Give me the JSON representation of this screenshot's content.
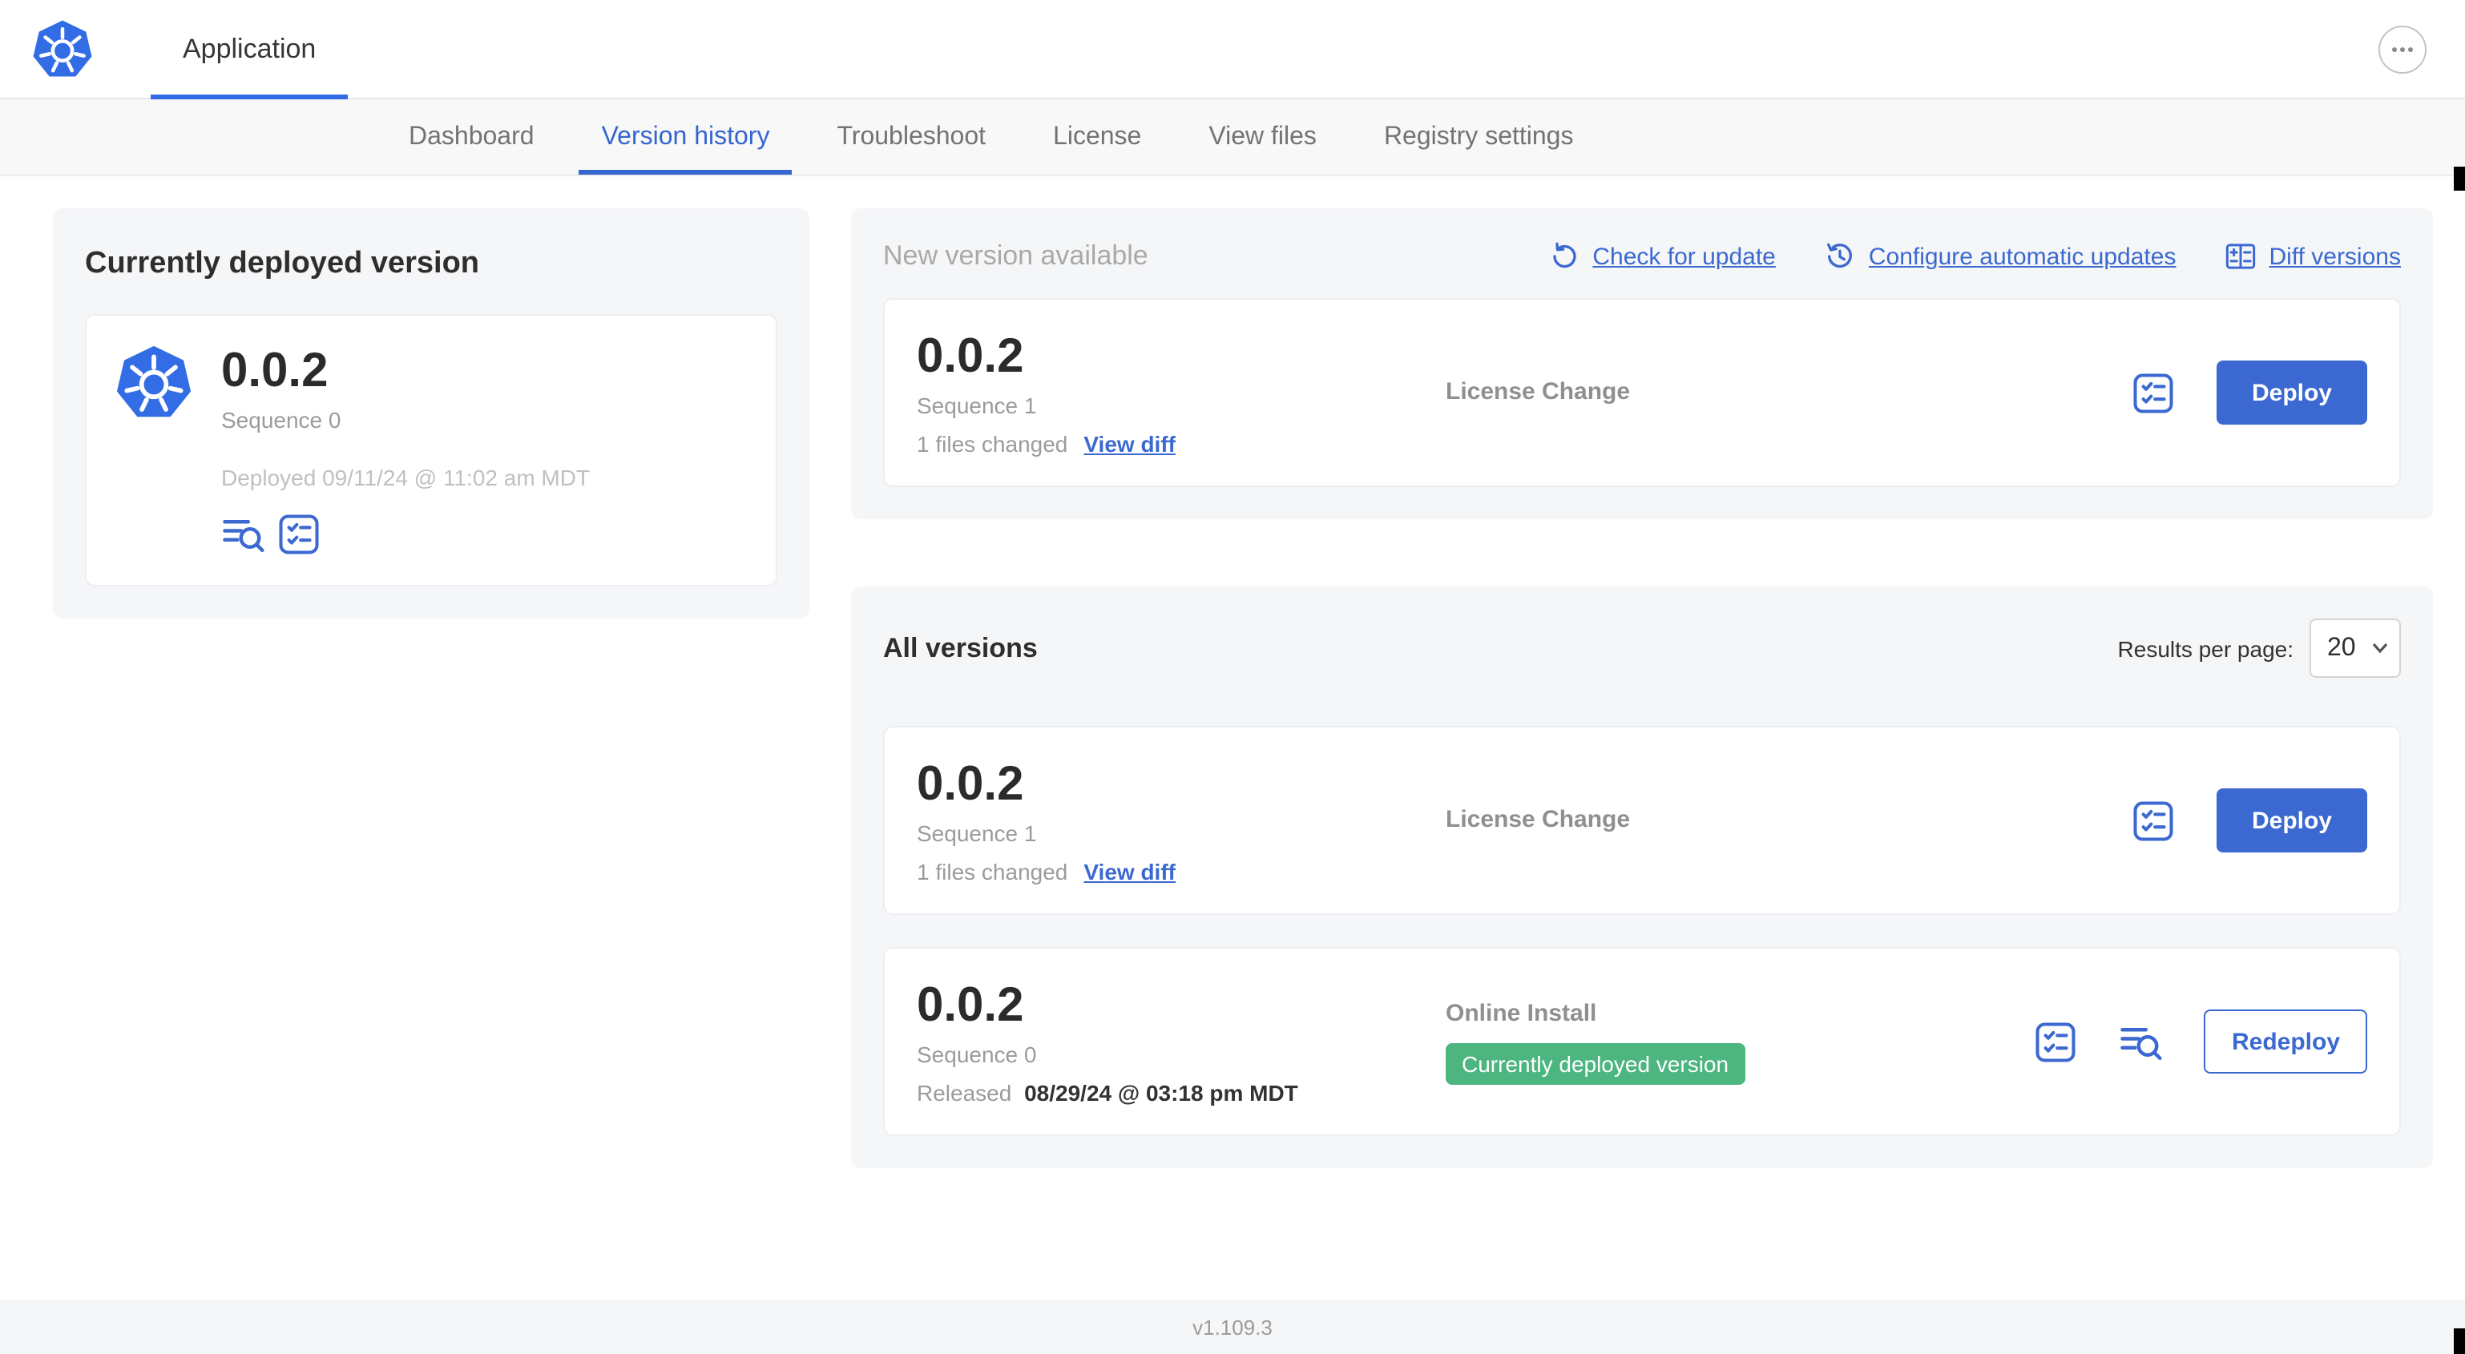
{
  "header": {
    "app_tab_label": "Application"
  },
  "nav": {
    "active_tab": "Version history",
    "tabs": [
      {
        "label": "Dashboard"
      },
      {
        "label": "Version history"
      },
      {
        "label": "Troubleshoot"
      },
      {
        "label": "License"
      },
      {
        "label": "View files"
      },
      {
        "label": "Registry settings"
      }
    ]
  },
  "current_version": {
    "title": "Currently deployed version",
    "version": "0.0.2",
    "sequence": "Sequence 0",
    "deployed": "Deployed 09/11/24 @ 11:02 am MDT"
  },
  "new_version": {
    "title": "New version available",
    "check_link": "Check for update",
    "auto_link": "Configure automatic updates",
    "diff_link": "Diff versions",
    "card": {
      "version": "0.0.2",
      "sequence": "Sequence 1",
      "files_changed": "1 files changed",
      "view_diff": "View diff",
      "source": "License Change",
      "deploy_label": "Deploy"
    }
  },
  "all_versions": {
    "title": "All versions",
    "results_label": "Results per page:",
    "results_value": "20",
    "rows": [
      {
        "version": "0.0.2",
        "sequence": "Sequence 1",
        "files_changed": "1 files changed",
        "view_diff": "View diff",
        "source": "License Change",
        "action_label": "Deploy"
      },
      {
        "version": "0.0.2",
        "sequence": "Sequence 0",
        "released_label": "Released",
        "released_date": "08/29/24 @ 03:18 pm MDT",
        "source": "Online Install",
        "badge": "Currently deployed version",
        "action_label": "Redeploy"
      }
    ]
  },
  "footer": {
    "app_version": "v1.109.3"
  },
  "colors": {
    "accent_blue": "#326de6",
    "link_blue": "#3b69d1",
    "badge_green": "#4cb580",
    "panel_gray": "#f5f6f8"
  },
  "icons": {
    "logo": "kubernetes-wheel",
    "overflow": "ellipsis",
    "check_update": "refresh-ccw-arrow",
    "auto_update": "clock-arrow",
    "diff": "diff-table",
    "config": "checklist",
    "logs": "logs-magnifier",
    "select_chevron": "chevron-down"
  }
}
